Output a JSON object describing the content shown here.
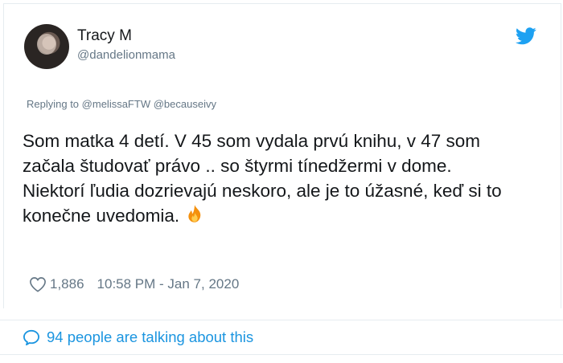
{
  "tweet": {
    "author_name": "Tracy M",
    "author_handle": "@dandelionmama",
    "replying_prefix": "Replying to",
    "replying_to_1": "@melissaFTW",
    "replying_to_2": "@becauseivy",
    "text": "Som matka 4 detí. V 45 som vydala prvú knihu, v 47 som začala študovať právo .. so štyrmi tínedžermi v dome. Niektorí ľudia dozrievajú neskoro, ale je to úžasné, keď si to konečne uvedomia.",
    "likes": "1,886",
    "timestamp": "10:58 PM - Jan 7, 2020",
    "talking": "94 people are talking about this"
  },
  "icons": {
    "platform": "twitter-bird-icon",
    "like": "heart-icon",
    "reply_bubble": "speech-bubble-icon",
    "emoji": "fire-emoji-icon"
  },
  "colors": {
    "twitter_blue": "#1da1f2",
    "link_blue": "#1b95e0",
    "muted": "#657786",
    "text": "#14171a",
    "border": "#e6ecf0"
  }
}
